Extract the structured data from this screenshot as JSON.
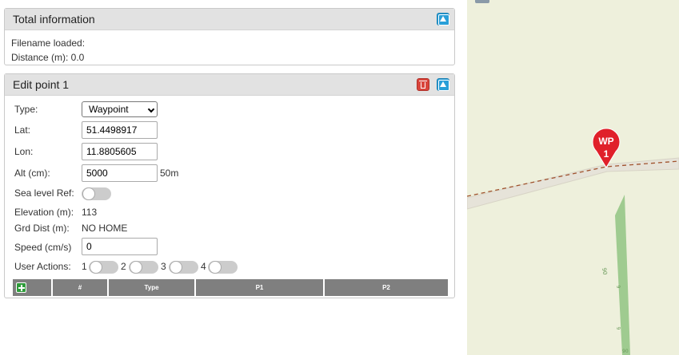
{
  "total_info": {
    "title": "Total information",
    "filename_label": "Filename loaded:",
    "distance_label": "Distance (m): 0.0"
  },
  "edit_point": {
    "title": "Edit point 1",
    "type_label": "Type:",
    "type_value": "Waypoint",
    "lat_label": "Lat:",
    "lat_value": "51.4498917",
    "lon_label": "Lon:",
    "lon_value": "11.8805605",
    "alt_label": "Alt (cm):",
    "alt_value": "5000",
    "alt_unit": "50m",
    "sea_level_label": "Sea level Ref:",
    "elevation_label": "Elevation (m):",
    "elevation_value": "113",
    "grd_dist_label": "Grd Dist (m):",
    "grd_dist_value": "NO HOME",
    "speed_label": "Speed (cm/s)",
    "speed_value": "0",
    "user_actions_label": "User Actions:",
    "user_actions": [
      "1",
      "2",
      "3",
      "4"
    ]
  },
  "table": {
    "columns": [
      "#",
      "Type",
      "P1",
      "P2"
    ]
  },
  "map": {
    "marker_label": "WP",
    "marker_number": "1",
    "colors": {
      "background": "#eef0dc",
      "marker": "#e0202a",
      "path": "#a0522d",
      "road": "#e8e4d8",
      "green_strip": "#9fcb90"
    }
  }
}
